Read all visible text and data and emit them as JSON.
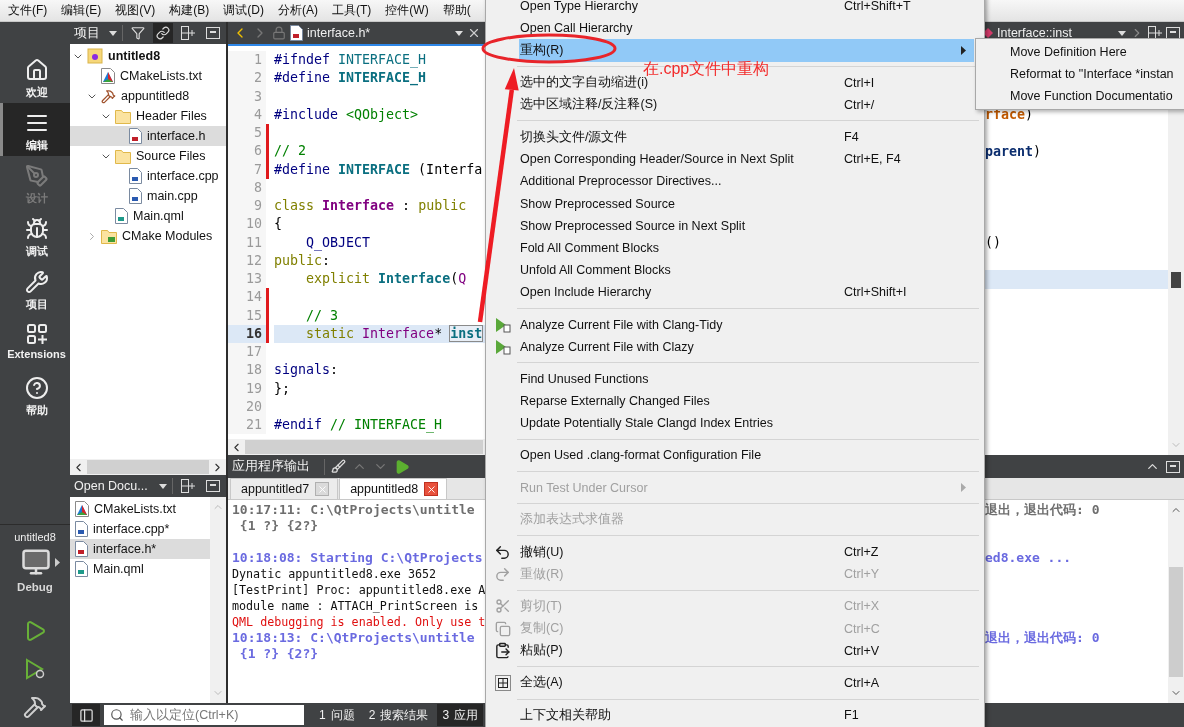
{
  "menubar": [
    "文件(F)",
    "编辑(E)",
    "视图(V)",
    "构建(B)",
    "调试(D)",
    "分析(A)",
    "工具(T)",
    "控件(W)",
    "帮助("
  ],
  "modes": [
    {
      "label": "欢迎",
      "kind": "welcome",
      "selected": false,
      "disabled": false
    },
    {
      "label": "编辑",
      "kind": "edit",
      "selected": true,
      "disabled": false
    },
    {
      "label": "设计",
      "kind": "design",
      "selected": false,
      "disabled": true
    },
    {
      "label": "调试",
      "kind": "debug",
      "selected": false,
      "disabled": false
    },
    {
      "label": "项目",
      "kind": "projects",
      "selected": false,
      "disabled": false
    },
    {
      "label": "Extensions",
      "kind": "extensions",
      "selected": false,
      "disabled": false
    },
    {
      "label": "帮助",
      "kind": "help",
      "selected": false,
      "disabled": false
    }
  ],
  "target": {
    "project": "untitled8",
    "config": "Debug"
  },
  "project_panel": {
    "title": "项目",
    "tree": [
      {
        "label": "untitled8",
        "kind": "project",
        "expanded": true,
        "selected": false,
        "children": [
          {
            "label": "CMakeLists.txt",
            "kind": "cmake",
            "selected": false
          },
          {
            "label": "appuntitled8",
            "kind": "target",
            "expanded": true,
            "selected": false,
            "children": [
              {
                "label": "Header Files",
                "kind": "folder",
                "expanded": true,
                "selected": false,
                "children": [
                  {
                    "label": "interface.h",
                    "kind": "header",
                    "selected": true
                  }
                ]
              },
              {
                "label": "Source Files",
                "kind": "folder",
                "expanded": true,
                "selected": false,
                "children": [
                  {
                    "label": "interface.cpp",
                    "kind": "source",
                    "selected": false
                  },
                  {
                    "label": "main.cpp",
                    "kind": "source",
                    "selected": false
                  }
                ]
              },
              {
                "label": "Main.qml",
                "kind": "qml",
                "selected": false
              }
            ]
          },
          {
            "label": "CMake Modules",
            "kind": "modules",
            "expanded": false,
            "selected": false
          }
        ]
      }
    ]
  },
  "open_documents": {
    "title": "Open Docu...",
    "files": [
      {
        "name": "CMakeLists.txt",
        "kind": "cmake",
        "selected": false
      },
      {
        "name": "interface.cpp*",
        "kind": "source",
        "selected": false
      },
      {
        "name": "interface.h*",
        "kind": "header",
        "selected": true
      },
      {
        "name": "Main.qml",
        "kind": "qml",
        "selected": false
      }
    ]
  },
  "editor": {
    "file": "interface.h*",
    "lines": [
      {
        "number": "1",
        "changed": false,
        "current": false,
        "tokens": [
          {
            "text": "#ifndef",
            "kind": "directive"
          },
          {
            "text": " INTERFACE_H",
            "kind": "macro"
          }
        ]
      },
      {
        "number": "2",
        "changed": false,
        "current": false,
        "tokens": [
          {
            "text": "#define",
            "kind": "directive"
          },
          {
            "text": " INTERFACE_H",
            "kind": "macro_def"
          }
        ]
      },
      {
        "number": "3",
        "changed": false,
        "current": false
      },
      {
        "number": "4",
        "changed": false,
        "current": false,
        "tokens": [
          {
            "text": "#include",
            "kind": "directive"
          },
          {
            "text": " <QObject>",
            "kind": "include"
          }
        ]
      },
      {
        "number": "5",
        "changed": true,
        "current": false
      },
      {
        "number": "6",
        "changed": true,
        "current": false,
        "tokens": [
          {
            "text": "// 2",
            "kind": "comment"
          }
        ]
      },
      {
        "number": "7",
        "changed": true,
        "current": false,
        "tokens": [
          {
            "text": "#define",
            "kind": "directive"
          },
          {
            "text": " INTERFACE",
            "kind": "macro_def"
          },
          {
            "text": " (Interfa",
            "kind": "plain"
          }
        ]
      },
      {
        "number": "8",
        "changed": false,
        "current": false
      },
      {
        "number": "9",
        "changed": false,
        "current": false,
        "tokens": [
          {
            "text": "class",
            "kind": "keyword"
          },
          {
            "text": " Interface",
            "kind": "type_def"
          },
          {
            "text": " : ",
            "kind": "plain"
          },
          {
            "text": "public",
            "kind": "keyword"
          }
        ]
      },
      {
        "number": "10",
        "changed": false,
        "current": false,
        "tokens": [
          {
            "text": "{",
            "kind": "plain"
          }
        ]
      },
      {
        "number": "11",
        "changed": false,
        "current": false,
        "tokens": [
          {
            "text": "    Q_OBJECT",
            "kind": "directive"
          }
        ]
      },
      {
        "number": "12",
        "changed": false,
        "current": false,
        "tokens": [
          {
            "text": "public",
            "kind": "keyword"
          },
          {
            "text": ":",
            "kind": "plain"
          }
        ]
      },
      {
        "number": "13",
        "changed": false,
        "current": false,
        "tokens": [
          {
            "text": "    explicit",
            "kind": "keyword"
          },
          {
            "text": " Interface",
            "kind": "func"
          },
          {
            "text": "(",
            "kind": "plain"
          },
          {
            "text": "Q",
            "kind": "type"
          }
        ]
      },
      {
        "number": "14",
        "changed": true,
        "current": false
      },
      {
        "number": "15",
        "changed": true,
        "current": false,
        "tokens": [
          {
            "text": "    // 3",
            "kind": "comment"
          }
        ]
      },
      {
        "number": "16",
        "changed": true,
        "current": true,
        "tokens": [
          {
            "text": "    static",
            "kind": "keyword"
          },
          {
            "text": " Interface",
            "kind": "type"
          },
          {
            "text": "* ",
            "kind": "plain"
          },
          {
            "text": "inst",
            "kind": "selected"
          }
        ]
      },
      {
        "number": "17",
        "changed": false,
        "current": false
      },
      {
        "number": "18",
        "changed": false,
        "current": false,
        "tokens": [
          {
            "text": "signals",
            "kind": "directive"
          },
          {
            "text": ":",
            "kind": "plain"
          }
        ]
      },
      {
        "number": "19",
        "changed": false,
        "current": false,
        "tokens": [
          {
            "text": "};",
            "kind": "plain"
          }
        ]
      },
      {
        "number": "20",
        "changed": false,
        "current": false
      },
      {
        "number": "21",
        "changed": false,
        "current": false,
        "tokens": [
          {
            "text": "#endif",
            "kind": "directive"
          },
          {
            "text": " // INTERFACE_H",
            "kind": "comment"
          }
        ]
      }
    ]
  },
  "right_editor": {
    "symbol": "Interface::inst",
    "lines": [
      {
        "current": false,
        "tokens": [
          {
            "text": "rface",
            "kind": "member"
          },
          {
            "text": ")",
            "kind": "plain"
          }
        ]
      },
      {
        "current": false
      },
      {
        "current": false,
        "tokens": [
          {
            "text": "parent",
            "kind": "param"
          },
          {
            "text": ")",
            "kind": "plain"
          }
        ]
      },
      {
        "current": false
      },
      {
        "current": false
      },
      {
        "current": false
      },
      {
        "current": false
      },
      {
        "current": false,
        "tokens": [
          {
            "text": "()",
            "kind": "plain"
          }
        ]
      },
      {
        "current": false
      },
      {
        "current": true
      }
    ]
  },
  "output": {
    "title": "应用程序输出",
    "tabs": [
      {
        "label": "appuntitled7",
        "selected": false
      },
      {
        "label": "appuntitled8",
        "selected": true
      }
    ],
    "lines": [
      {
        "kind": "info",
        "text": "10:17:11: C:\\QtProjects\\untitle",
        "tail": "退出，退出代码: 0"
      },
      {
        "kind": "info",
        "text": " {1 ?} {2?}"
      },
      {
        "kind": "blank"
      },
      {
        "kind": "start",
        "text": "10:18:08: Starting C:\\QtProjects",
        "tail": "ed8.exe ..."
      },
      {
        "kind": "plain",
        "text": "Dynatic appuntitled8.exe 3652"
      },
      {
        "kind": "plain",
        "text": "[TestPrint] Proc: appuntitled8.exe A"
      },
      {
        "kind": "plain",
        "text": "module name : ATTACH_PrintScreen is"
      },
      {
        "kind": "error",
        "text": "QML debugging is enabled. Only use t"
      },
      {
        "kind": "start",
        "text": "10:18:13: C:\\QtProjects\\untitle",
        "tail": "退出，退出代码: 0"
      },
      {
        "kind": "start",
        "text": " {1 ?} {2?}"
      }
    ]
  },
  "status_bar": {
    "search_placeholder": "输入以定位(Ctrl+K)",
    "panes": [
      {
        "number": "1",
        "label": "问题",
        "selected": false
      },
      {
        "number": "2",
        "label": "搜索结果",
        "selected": false
      },
      {
        "number": "3",
        "label": "应用",
        "selected": true
      }
    ]
  },
  "context_menu": {
    "groups": [
      {
        "items": [
          {
            "label": "Open Type Hierarchy",
            "shortcut": "Ctrl+Shift+T",
            "kind": "plain",
            "selected": false,
            "disabled": false,
            "submenu": false
          },
          {
            "label": "Open Call Hierarchy",
            "kind": "plain",
            "selected": false,
            "disabled": false,
            "submenu": false
          },
          {
            "label": "重构(R)",
            "kind": "plain",
            "selected": true,
            "disabled": false,
            "submenu": true
          }
        ]
      },
      {
        "items": [
          {
            "label": "选中的文字自动缩进(i)",
            "shortcut": "Ctrl+I",
            "kind": "plain",
            "selected": false,
            "disabled": false,
            "submenu": false
          },
          {
            "label": "选中区域注释/反注释(S)",
            "shortcut": "Ctrl+/",
            "kind": "plain",
            "selected": false,
            "disabled": false,
            "submenu": false
          }
        ]
      },
      {
        "items": [
          {
            "label": "切换头文件/源文件",
            "shortcut": "F4",
            "kind": "plain",
            "selected": false,
            "disabled": false,
            "submenu": false
          },
          {
            "label": "Open Corresponding Header/Source in Next Split",
            "shortcut": "Ctrl+E, F4",
            "kind": "plain",
            "selected": false,
            "disabled": false,
            "submenu": false
          },
          {
            "label": "Additional Preprocessor Directives...",
            "kind": "plain",
            "selected": false,
            "disabled": false,
            "submenu": false
          },
          {
            "label": "Show Preprocessed Source",
            "kind": "plain",
            "selected": false,
            "disabled": false,
            "submenu": false
          },
          {
            "label": "Show Preprocessed Source in Next Split",
            "kind": "plain",
            "selected": false,
            "disabled": false,
            "submenu": false
          },
          {
            "label": "Fold All Comment Blocks",
            "kind": "plain",
            "selected": false,
            "disabled": false,
            "submenu": false
          },
          {
            "label": "Unfold All Comment Blocks",
            "kind": "plain",
            "selected": false,
            "disabled": false,
            "submenu": false
          },
          {
            "label": "Open Include Hierarchy",
            "shortcut": "Ctrl+Shift+I",
            "kind": "plain",
            "selected": false,
            "disabled": false,
            "submenu": false
          }
        ]
      },
      {
        "items": [
          {
            "label": "Analyze Current File with Clang-Tidy",
            "kind": "analyze",
            "selected": false,
            "disabled": false,
            "submenu": false
          },
          {
            "label": "Analyze Current File with Clazy",
            "kind": "analyze",
            "selected": false,
            "disabled": false,
            "submenu": false
          }
        ]
      },
      {
        "items": [
          {
            "label": "Find Unused Functions",
            "kind": "plain",
            "selected": false,
            "disabled": false,
            "submenu": false
          },
          {
            "label": "Reparse Externally Changed Files",
            "kind": "plain",
            "selected": false,
            "disabled": false,
            "submenu": false
          },
          {
            "label": "Update Potentially Stale Clangd Index Entries",
            "kind": "plain",
            "selected": false,
            "disabled": false,
            "submenu": false
          }
        ]
      },
      {
        "items": [
          {
            "label": "Open Used .clang-format Configuration File",
            "kind": "plain",
            "selected": false,
            "disabled": false,
            "submenu": false
          }
        ]
      },
      {
        "items": [
          {
            "label": "Run Test Under Cursor",
            "kind": "plain",
            "selected": false,
            "disabled": true,
            "submenu": true
          }
        ]
      },
      {
        "items": [
          {
            "label": "添加表达式求值器",
            "kind": "plain",
            "selected": false,
            "disabled": true,
            "submenu": false
          }
        ]
      },
      {
        "items": [
          {
            "label": "撤销(U)",
            "shortcut": "Ctrl+Z",
            "kind": "undo",
            "selected": false,
            "disabled": false,
            "submenu": false
          },
          {
            "label": "重做(R)",
            "shortcut": "Ctrl+Y",
            "kind": "redo",
            "selected": false,
            "disabled": true,
            "submenu": false
          }
        ]
      },
      {
        "items": [
          {
            "label": "剪切(T)",
            "shortcut": "Ctrl+X",
            "kind": "cut",
            "selected": false,
            "disabled": true,
            "submenu": false
          },
          {
            "label": "复制(C)",
            "shortcut": "Ctrl+C",
            "kind": "copy",
            "selected": false,
            "disabled": true,
            "submenu": false
          },
          {
            "label": "粘贴(P)",
            "shortcut": "Ctrl+V",
            "kind": "paste",
            "selected": false,
            "disabled": false,
            "submenu": false
          }
        ]
      },
      {
        "items": [
          {
            "label": "全选(A)",
            "shortcut": "Ctrl+A",
            "kind": "select_all",
            "selected": false,
            "disabled": false,
            "submenu": false
          }
        ]
      },
      {
        "items": [
          {
            "label": "上下文相关帮助",
            "shortcut": "F1",
            "kind": "plain",
            "selected": false,
            "disabled": false,
            "submenu": false
          }
        ]
      }
    ]
  },
  "submenu": {
    "items": [
      {
        "label": "Move Definition Here"
      },
      {
        "label": "Reformat to \"Interface *instan"
      },
      {
        "label": "Move Function Documentatio"
      }
    ]
  },
  "annotation": {
    "text": "在.cpp文件中重构"
  }
}
